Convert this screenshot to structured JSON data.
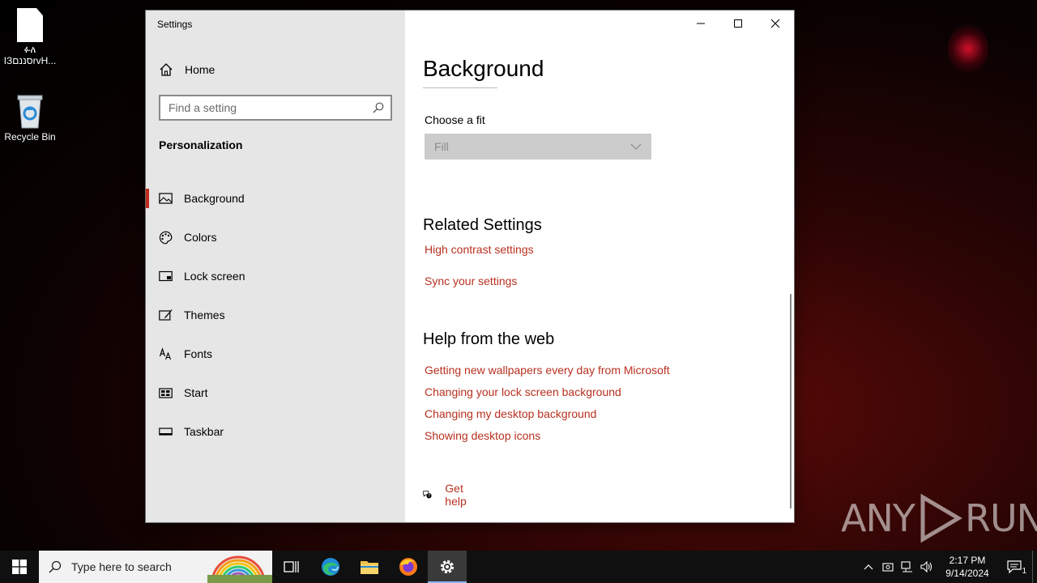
{
  "desktop": {
    "icons": [
      {
        "label": "ፉለ ӀЗסננםrvH..."
      },
      {
        "label": "Recycle Bin"
      }
    ]
  },
  "window": {
    "title": "Settings",
    "controls": {
      "minimize": "minimize-icon",
      "maximize": "maximize-icon",
      "close": "close-icon"
    }
  },
  "sidebar": {
    "home_label": "Home",
    "search_placeholder": "Find a setting",
    "section_title": "Personalization",
    "items": [
      {
        "label": "Background",
        "icon": "picture-icon",
        "active": true
      },
      {
        "label": "Colors",
        "icon": "palette-icon"
      },
      {
        "label": "Lock screen",
        "icon": "lock-screen-icon"
      },
      {
        "label": "Themes",
        "icon": "brush-icon"
      },
      {
        "label": "Fonts",
        "icon": "font-icon"
      },
      {
        "label": "Start",
        "icon": "start-icon"
      },
      {
        "label": "Taskbar",
        "icon": "taskbar-icon"
      }
    ]
  },
  "main": {
    "title": "Background",
    "fit_label": "Choose a fit",
    "fit_value": "Fill",
    "related_title": "Related Settings",
    "related_links": [
      "High contrast settings",
      "Sync your settings"
    ],
    "help_title": "Help from the web",
    "help_links": [
      "Getting new wallpapers every day from Microsoft",
      "Changing your lock screen background",
      "Changing my desktop background",
      "Showing desktop icons"
    ],
    "get_help": "Get help"
  },
  "colors": {
    "accent_link": "#b8301f",
    "active_indicator": "#c42b1c",
    "sidebar_bg": "#e6e6e6"
  },
  "watermark": {
    "left": "ANY",
    "right": "RUN"
  },
  "taskbar": {
    "search_placeholder": "Type here to search",
    "time": "2:17 PM",
    "date": "9/14/2024",
    "notification_count": "1"
  }
}
